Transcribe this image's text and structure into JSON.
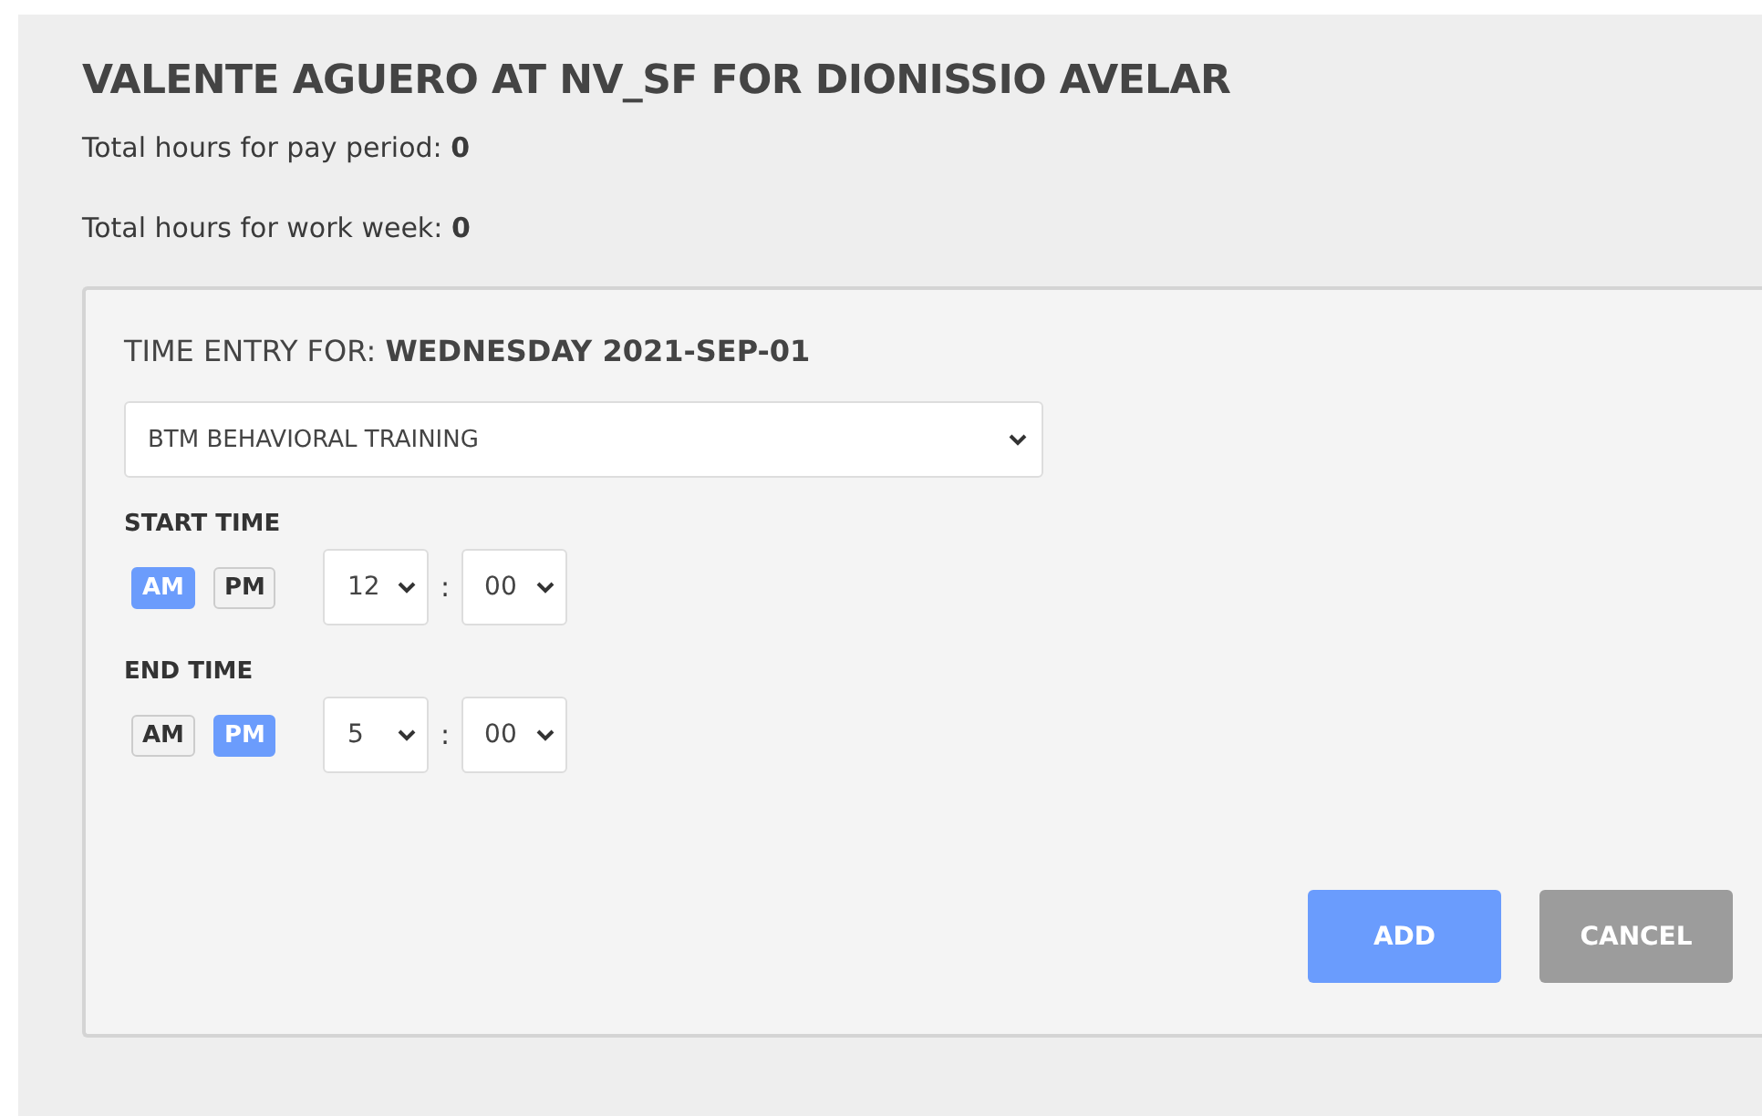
{
  "title": "VALENTE AGUERO AT NV_SF FOR DIONISSIO AVELAR",
  "totals": [
    "Total hours for pay period: **0**",
    "Total hours for work week: **0**"
  ],
  "entry": {
    "heading": "TIME ENTRY FOR: **WEDNESDAY 2021-SEP-01**",
    "activity": "BTM BEHAVIORAL TRAINING",
    "times": [
      {
        "label": "START TIME",
        "periods": [
          {
            "label": "AM",
            "selected": true
          },
          {
            "label": "PM",
            "selected": false
          }
        ],
        "hour": "12",
        "separator": ":",
        "minute": "00"
      },
      {
        "label": "END TIME",
        "periods": [
          {
            "label": "AM",
            "selected": false
          },
          {
            "label": "PM",
            "selected": true
          }
        ],
        "hour": "5",
        "separator": ":",
        "minute": "00"
      }
    ],
    "buttons": [
      {
        "label": "ADD",
        "kind": "primary"
      },
      {
        "label": "CANCEL",
        "kind": "secondary"
      }
    ]
  }
}
